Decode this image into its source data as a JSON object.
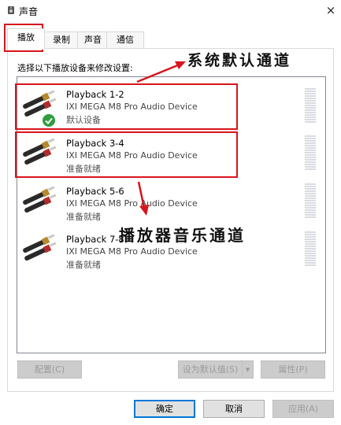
{
  "window": {
    "title": "声音",
    "icon": "speaker-icon",
    "close_glyph": "×"
  },
  "tabs": [
    {
      "label": "播放",
      "active": true
    },
    {
      "label": "录制",
      "active": false
    },
    {
      "label": "声音",
      "active": false
    },
    {
      "label": "通信",
      "active": false
    }
  ],
  "instruction": "选择以下播放设备来修改设置:",
  "devices": [
    {
      "name": "Playback 1-2",
      "description": "IXI MEGA M8 Pro Audio Device",
      "status": "默认设备",
      "default": true
    },
    {
      "name": "Playback 3-4",
      "description": "IXI MEGA M8 Pro Audio Device",
      "status": "准备就绪",
      "default": false
    },
    {
      "name": "Playback 5-6",
      "description": "IXI MEGA M8 Pro Audio Device",
      "status": "准备就绪",
      "default": false
    },
    {
      "name": "Playback 7-8",
      "description": "IXI MEGA M8 Pro Audio Device",
      "status": "准备就绪",
      "default": false
    }
  ],
  "annotations": {
    "system_channel": "系统默认通道",
    "music_channel": "播放器音乐通道",
    "color": "#d9141c"
  },
  "buttons": {
    "configure": "配置(C)",
    "set_default": "设为默认值(S)",
    "set_default_arrow": "▾",
    "properties": "属性(P)",
    "ok": "确定",
    "cancel": "取消",
    "apply": "应用(A)"
  },
  "colors": {
    "accent": "#0078d7",
    "highlight": "#d9141c",
    "check": "#2e9d3e"
  }
}
